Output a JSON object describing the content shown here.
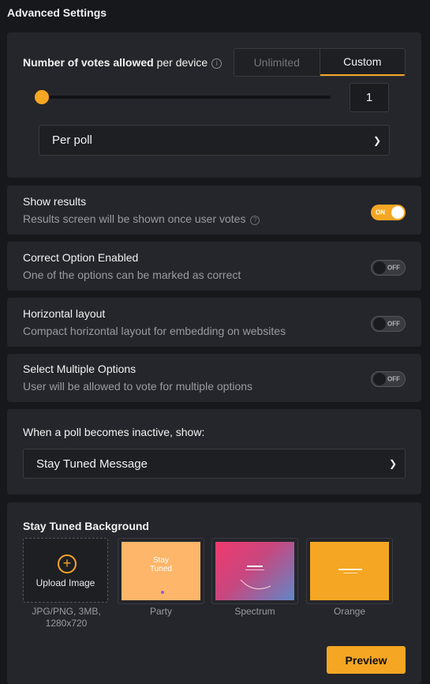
{
  "header": {
    "title": "Advanced Settings"
  },
  "votes": {
    "label_bold": "Number of votes allowed",
    "label_rest": " per device",
    "info_icon": "i",
    "mode_options": [
      "Unlimited",
      "Custom"
    ],
    "selected_mode": "Custom",
    "slider_value": 1,
    "count": "1",
    "period": "Per poll"
  },
  "toggles": [
    {
      "title": "Show results",
      "subtitle": "Results screen will be shown once user votes",
      "state": "ON",
      "has_help": true
    },
    {
      "title": "Correct Option Enabled",
      "subtitle": "One of the options can be marked as correct",
      "state": "OFF"
    },
    {
      "title": "Horizontal layout",
      "subtitle": "Compact horizontal layout for embedding on websites",
      "state": "OFF"
    },
    {
      "title": "Select Multiple Options",
      "subtitle": "User will be allowed to vote for multiple options",
      "state": "OFF"
    }
  ],
  "inactive": {
    "label": "When a poll becomes inactive, show:",
    "value": "Stay Tuned Message"
  },
  "background": {
    "title": "Stay Tuned Background",
    "upload_label": "Upload Image",
    "upload_note": "JPG/PNG, 3MB, 1280x720",
    "party_text_line1": "Stay",
    "party_text_line2": "Tuned",
    "options": [
      {
        "label": "Party",
        "color": "#fdb66a"
      },
      {
        "label": "Spectrum",
        "color": "#e0447a"
      },
      {
        "label": "Orange",
        "color": "#f5a623"
      }
    ],
    "preview_label": "Preview"
  },
  "colors": {
    "accent": "#f5a623",
    "card": "#25262b",
    "page": "#17181c"
  }
}
